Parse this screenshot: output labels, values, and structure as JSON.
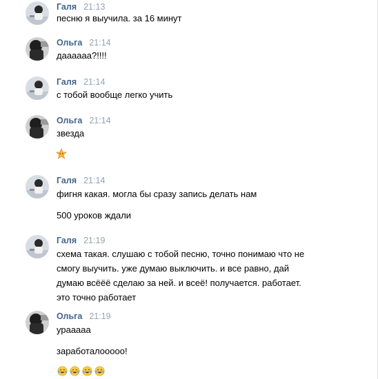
{
  "messages": [
    {
      "author": "Галя",
      "time": "21:13",
      "avatar": "galya-avatar",
      "lines": [
        "песню я выучила. за 16 минут"
      ]
    },
    {
      "author": "Ольга",
      "time": "21:14",
      "avatar": "olga-avatar",
      "lines": [
        "даааааа?!!!!"
      ]
    },
    {
      "author": "Галя",
      "time": "21:14",
      "avatar": "galya-avatar",
      "lines": [
        "с тобой вообще легко учить"
      ]
    },
    {
      "author": "Ольга",
      "time": "21:14",
      "avatar": "olga-avatar",
      "lines": [
        "звезда"
      ],
      "emoji": "star-emoji"
    },
    {
      "author": "Галя",
      "time": "21:14",
      "avatar": "galya-avatar",
      "lines": [
        "фигня какая. могла бы сразу запись делать нам",
        "500 уроков ждали"
      ]
    },
    {
      "author": "Галя",
      "time": "21:19",
      "avatar": "galya-avatar",
      "lines": [
        "схема такая. слушаю с тобой песню, точно понимаю что не",
        "смогу выучить. уже думаю выключить. и все равно, дай",
        "думаю всёёё сделаю за ней. и всеё! получается. работает.",
        "это точно работает"
      ]
    },
    {
      "author": "Ольга",
      "time": "21:19",
      "avatar": "olga-avatar",
      "lines": [
        "урааааа",
        "заработалоoooo!"
      ],
      "emoji": "tears-of-joy-emoji x4"
    }
  ],
  "colors": {
    "author": "#42648b",
    "time": "#93a3b4",
    "text": "#000000",
    "background": "#ffffff"
  }
}
